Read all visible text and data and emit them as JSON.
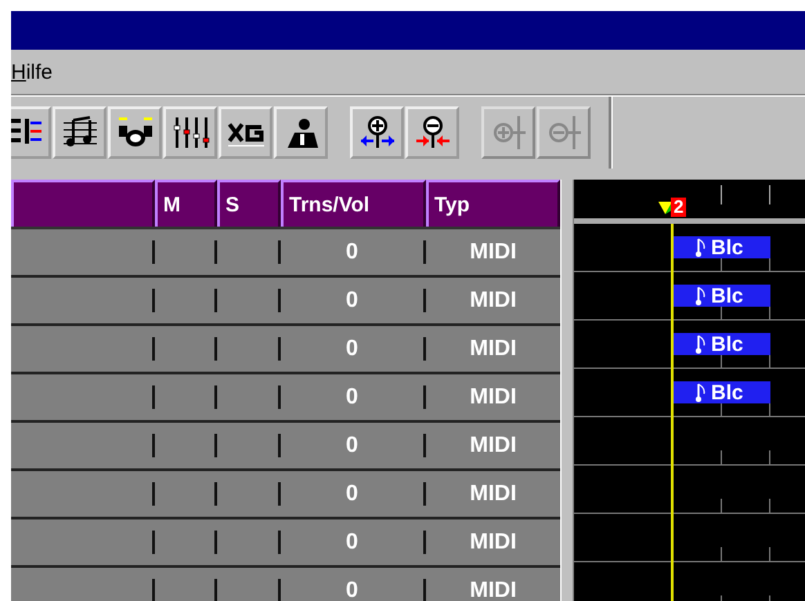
{
  "menu": [
    {
      "label": "Hilfe"
    }
  ],
  "toolbar": {
    "groups": [
      {
        "buttons": [
          {
            "kind": "list",
            "disabled": false
          },
          {
            "kind": "score",
            "disabled": false
          },
          {
            "kind": "drum",
            "disabled": false
          },
          {
            "kind": "mixer",
            "disabled": false
          },
          {
            "kind": "xg",
            "disabled": false
          },
          {
            "kind": "figure",
            "disabled": false
          }
        ]
      },
      {
        "buttons": [
          {
            "kind": "zoom-in-h",
            "disabled": false
          },
          {
            "kind": "zoom-out-h",
            "disabled": false
          }
        ]
      },
      {
        "buttons": [
          {
            "kind": "zoom-in-v",
            "disabled": true
          },
          {
            "kind": "zoom-out-v",
            "disabled": true
          }
        ]
      }
    ]
  },
  "table": {
    "columns": [
      "M",
      "S",
      "Trns/Vol",
      "Typ"
    ],
    "rows": [
      {
        "transpose": "0",
        "type": "MIDI",
        "part": "Blc"
      },
      {
        "transpose": "0",
        "type": "MIDI",
        "part": "Blc"
      },
      {
        "transpose": "0",
        "type": "MIDI",
        "part": "Blc"
      },
      {
        "transpose": "0",
        "type": "MIDI",
        "part": "Blc"
      },
      {
        "transpose": "0",
        "type": "MIDI"
      },
      {
        "transpose": "0",
        "type": "MIDI"
      },
      {
        "transpose": "0",
        "type": "MIDI"
      },
      {
        "transpose": "0",
        "type": "MIDI"
      }
    ]
  },
  "ruler": {
    "locator": "2"
  }
}
